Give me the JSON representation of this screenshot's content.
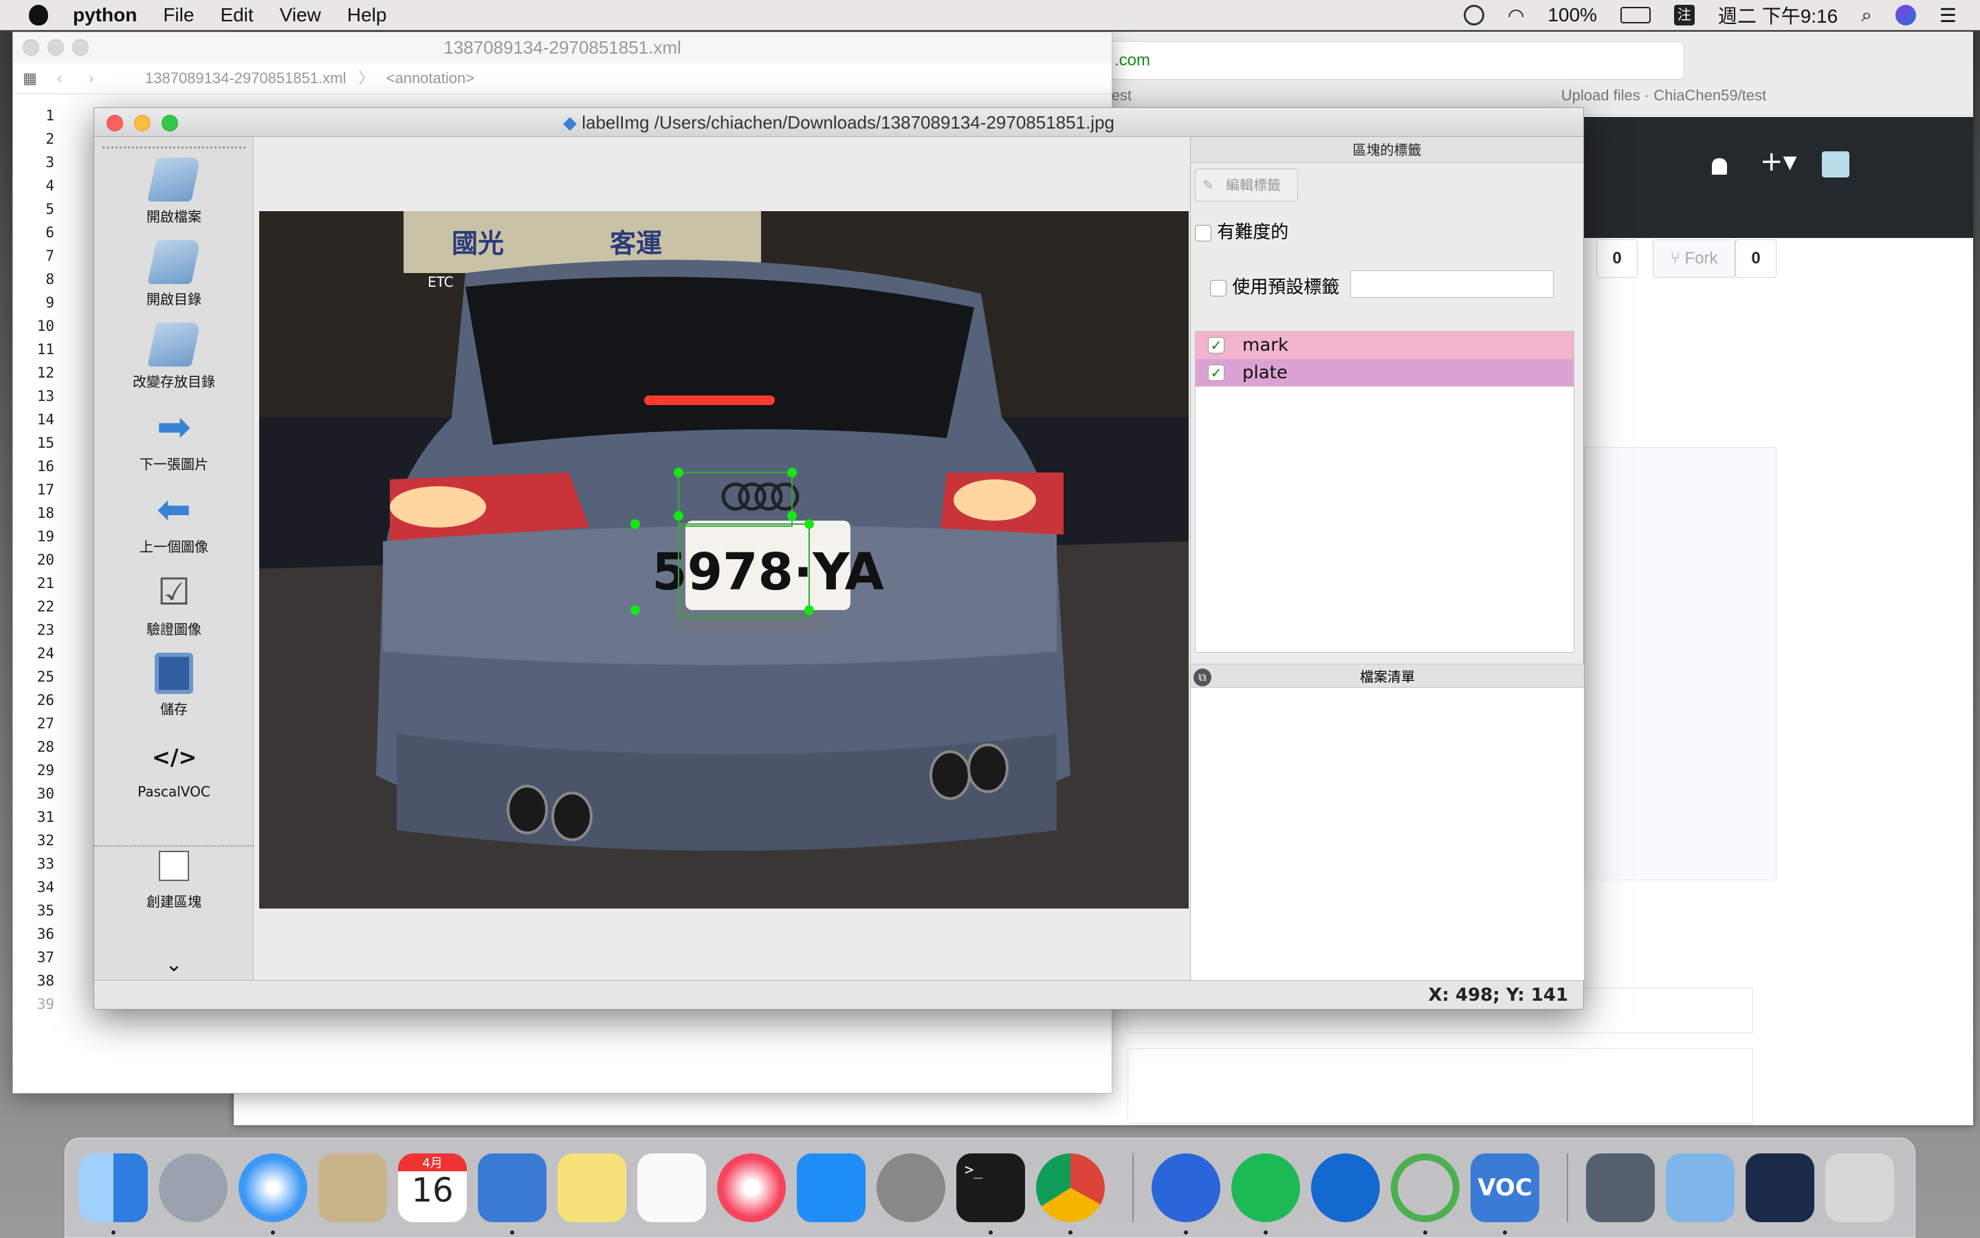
{
  "menubar": {
    "app_name": "python",
    "items": [
      "File",
      "Edit",
      "View",
      "Help"
    ],
    "battery": "100%",
    "input_method": "注",
    "clock": "週二 下午9:16"
  },
  "browser": {
    "url_fragment": ".com",
    "tab1": "59/test",
    "tab2": "Upload files · ChiaChen59/test",
    "star_count": "0",
    "fork_label": "Fork",
    "fork_count": "0"
  },
  "xml_editor": {
    "title": "1387089134-2970851851.xml",
    "breadcrumb_file": "1387089134-2970851851.xml",
    "breadcrumb_node": "<annotation>",
    "line_numbers": [
      "1",
      "2",
      "3",
      "4",
      "5",
      "6",
      "7",
      "8",
      "9",
      "10",
      "11",
      "12",
      "13",
      "14",
      "15",
      "16",
      "17",
      "18",
      "19",
      "20",
      "21",
      "22",
      "23",
      "24",
      "25",
      "26",
      "27",
      "28",
      "29",
      "30",
      "31",
      "32",
      "33",
      "34",
      "35",
      "36",
      "37",
      "38",
      "39"
    ]
  },
  "labelimg": {
    "title": "labelImg /Users/chiachen/Downloads/1387089134-2970851851.jpg",
    "tools": [
      "開啟檔案",
      "開啟目錄",
      "改變存放目錄",
      "下一張圖片",
      "上一個圖像",
      "驗證圖像",
      "儲存",
      "PascalVOC",
      "創建區塊"
    ],
    "panel_title": "區塊的標籤",
    "edit_label_button": "編輯標籤",
    "difficult_label": "有難度的",
    "default_label_checkbox": "使用預設標籤",
    "labels": [
      {
        "name": "mark",
        "color": "#f3b4cf",
        "checked": true
      },
      {
        "name": "plate",
        "color": "#dba3d4",
        "checked": true
      }
    ],
    "file_list_title": "檔案清單",
    "status": "X: 498; Y: 141",
    "photo": {
      "plate_text": "5978·YA",
      "signs": [
        "國光",
        "客運",
        "ETC"
      ]
    }
  },
  "dock": {
    "calendar_month": "4月",
    "calendar_day": "16"
  }
}
